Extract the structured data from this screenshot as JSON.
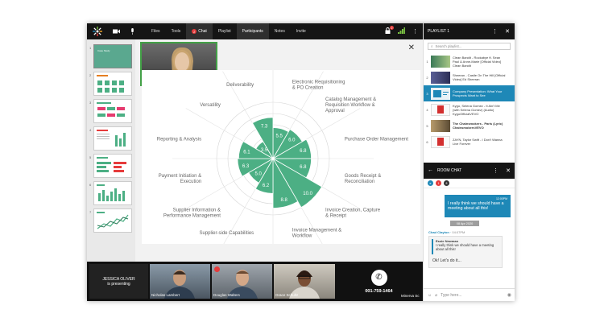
{
  "topbar": {
    "tabs": [
      {
        "label": "Files"
      },
      {
        "label": "Tools"
      },
      {
        "label": "Chat",
        "badge": "2"
      },
      {
        "label": "Playlist"
      },
      {
        "label": "Participants"
      },
      {
        "label": "Notes"
      },
      {
        "label": "Invite"
      }
    ],
    "lock_badge": "2"
  },
  "thumbnails": [
    "1",
    "2",
    "3",
    "4",
    "5",
    "6",
    "7"
  ],
  "presenter": {
    "name": "Jessica Oliver"
  },
  "spider_chart": {
    "categories": [
      "Electronic Requisitioning & PO Creation",
      "Catalog Management & Requisition Workflow & Approval",
      "Purchase Order Management",
      "Goods Receipt & Reconciliation",
      "Invoice Creation, Capture & Receipt",
      "Invoice Management & Workflow",
      "Supplier-side Capabilities",
      "Supplier Information & Performance Management",
      "Payment Initiation & Execution",
      "Reporting & Analysis",
      "Versatility",
      "Deliverability"
    ],
    "values": [
      "5.5",
      "6.0",
      "6.8",
      "6.8",
      "10.0",
      "8.8",
      "6.2",
      "5.0",
      "6.3",
      "6.1",
      "3.5",
      "7.3"
    ],
    "accent": "#4caf84"
  },
  "video_strip": {
    "presenting_name": "JESSICA OLIVER",
    "presenting_text": "is presenting",
    "participants": [
      {
        "name": "Nicholas Lambert"
      },
      {
        "name": "Douglas Walters"
      },
      {
        "name": "Grace Schultz"
      }
    ],
    "phone_number": "001-759-1464",
    "extra_participant": "Minerva Sc"
  },
  "playlist": {
    "title": "PLAYLIST 1",
    "search_placeholder": "Search playlist...",
    "items": [
      {
        "num": "1",
        "title": "Clean Bandit - Rockabye ft. Sean Paul & Anne-Marie [Official Video] Clean Bandit"
      },
      {
        "num": "2",
        "title": "Sheeran - Castle On The Hill [Official Video] Ed Sheeran"
      },
      {
        "num": "3",
        "title": "Company Presentation: What Your Prospects Want to See"
      },
      {
        "num": "4",
        "title": "Kygo, Selena Gomez - It Ain't Me (with Selena Gomez) (Audio) KygoOfficialVEVO"
      },
      {
        "num": "5",
        "title": "The Chainsmokers - Paris (Lyric) ChainsmokersVEVO"
      },
      {
        "num": "6",
        "title": "ZAYN, Taylor Swift - I Don't Wanna Live Forever"
      }
    ]
  },
  "chat": {
    "title": "ROOM CHAT",
    "tabs": [
      "e",
      "1",
      "8"
    ],
    "outgoing": {
      "time": "12:00PM",
      "text": "I really think we should have a meeting about all this!"
    },
    "date": "08 Apr 2020",
    "incoming": {
      "sender": "Chad Clayton",
      "time": "04:07PM",
      "quote_name": "Essie Newman",
      "quote_text": "I really think we should have a meeting about all this!",
      "reply": "Ok! Let's do it..."
    },
    "input_placeholder": "Type here..."
  }
}
